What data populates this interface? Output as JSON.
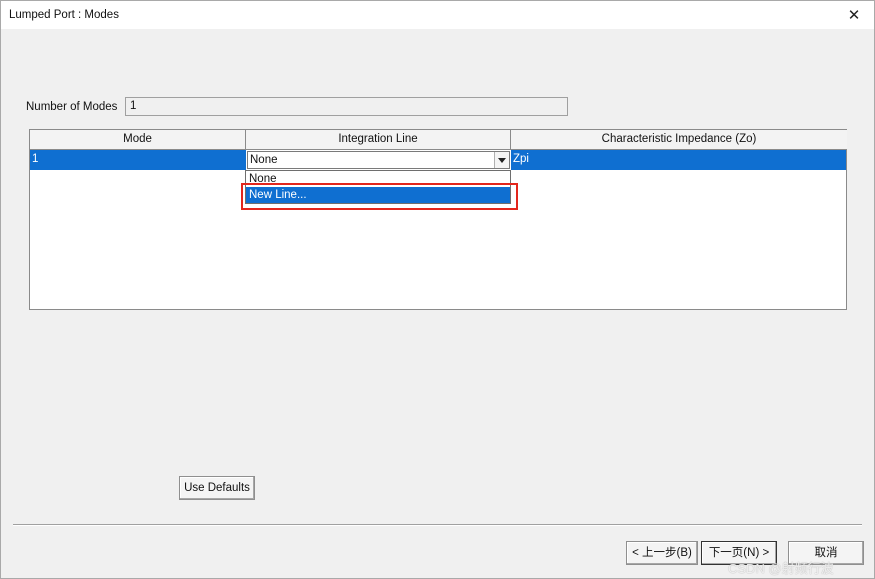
{
  "window": {
    "title": "Lumped Port : Modes",
    "close_icon": "close-icon"
  },
  "modes": {
    "label": "Number of Modes",
    "value": "1"
  },
  "grid": {
    "headers": [
      "Mode",
      "Integration Line",
      "Characteristic Impedance (Zo)"
    ],
    "row": {
      "mode": "1",
      "integration_line": "None",
      "impedance": "Zpi"
    }
  },
  "dropdown": {
    "options": [
      "None",
      "New Line..."
    ],
    "highlighted": "New Line..."
  },
  "buttons": {
    "use_defaults": "Use Defaults",
    "back": "< 上一步(B)",
    "next": "下一页(N) >",
    "cancel": "取消"
  },
  "watermark": "CSDN @射频行波",
  "colors": {
    "selection": "#0f6fd1",
    "highlight_box": "#e3261c"
  }
}
